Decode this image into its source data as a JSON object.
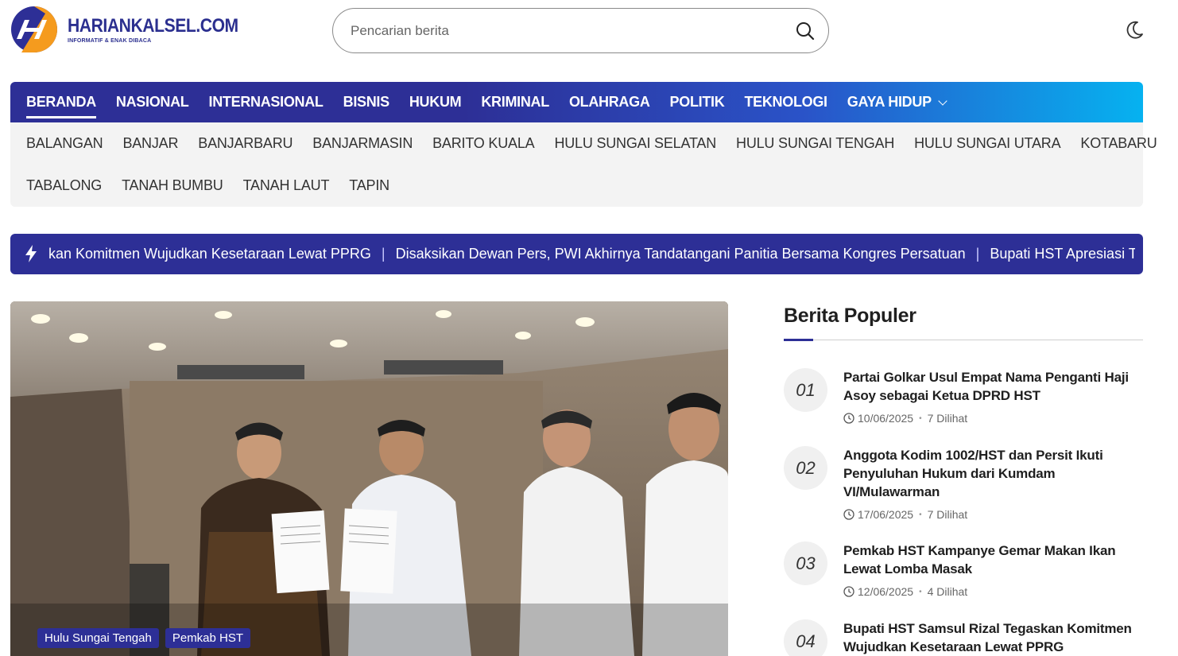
{
  "site": {
    "name": "HARIANKALSEL.COM",
    "tagline": "INFORMATIF & ENAK DIBACA"
  },
  "search": {
    "placeholder": "Pencarian berita"
  },
  "main_nav": [
    "BERANDA",
    "NASIONAL",
    "INTERNASIONAL",
    "BISNIS",
    "HUKUM",
    "KRIMINAL",
    "OLAHRAGA",
    "POLITIK",
    "TEKNOLOGI",
    "GAYA HIDUP"
  ],
  "sub_nav": {
    "row1": [
      "BALANGAN",
      "BANJAR",
      "BANJARBARU",
      "BANJARMASIN",
      "BARITO KUALA",
      "HULU SUNGAI SELATAN",
      "HULU SUNGAI TENGAH",
      "HULU SUNGAI UTARA",
      "KOTABARU"
    ],
    "row2": [
      "TABALONG",
      "TANAH BUMBU",
      "TANAH LAUT",
      "TAPIN"
    ]
  },
  "ticker": {
    "items": [
      "kan Komitmen Wujudkan Kesetaraan Lewat PPRG",
      "Disaksikan Dewan Pers, PWI Akhirnya Tandatangani Panitia Bersama Kongres Persatuan",
      "Bupati HST Apresiasi Tiga Pen"
    ],
    "separator": "|"
  },
  "hero": {
    "tags": [
      "Hulu Sungai Tengah",
      "Pemkab HST"
    ]
  },
  "popular": {
    "title": "Berita Populer",
    "items": [
      {
        "num": "01",
        "title": "Partai Golkar Usul Empat Nama Penganti Haji Asoy sebagai Ketua DPRD HST",
        "date": "10/06/2025",
        "views": "7 Dilihat"
      },
      {
        "num": "02",
        "title": "Anggota Kodim 1002/HST dan Persit Ikuti Penyuluhan Hukum dari Kumdam VI/Mulawarman",
        "date": "17/06/2025",
        "views": "7 Dilihat"
      },
      {
        "num": "03",
        "title": "Pemkab HST Kampanye Gemar Makan Ikan Lewat Lomba Masak",
        "date": "12/06/2025",
        "views": "4 Dilihat"
      },
      {
        "num": "04",
        "title": "Bupati HST Samsul Rizal Tegaskan Komitmen Wujudkan Kesetaraan Lewat PPRG",
        "date": "",
        "views": ""
      }
    ]
  },
  "icons": {
    "search": "search-icon",
    "theme": "moon-icon",
    "ticker": "lightning-icon",
    "clock": "clock-icon"
  },
  "colors": {
    "brand": "#2d2f96",
    "accent_blue": "#06b2f0",
    "logo_orange": "#f59b1e"
  }
}
